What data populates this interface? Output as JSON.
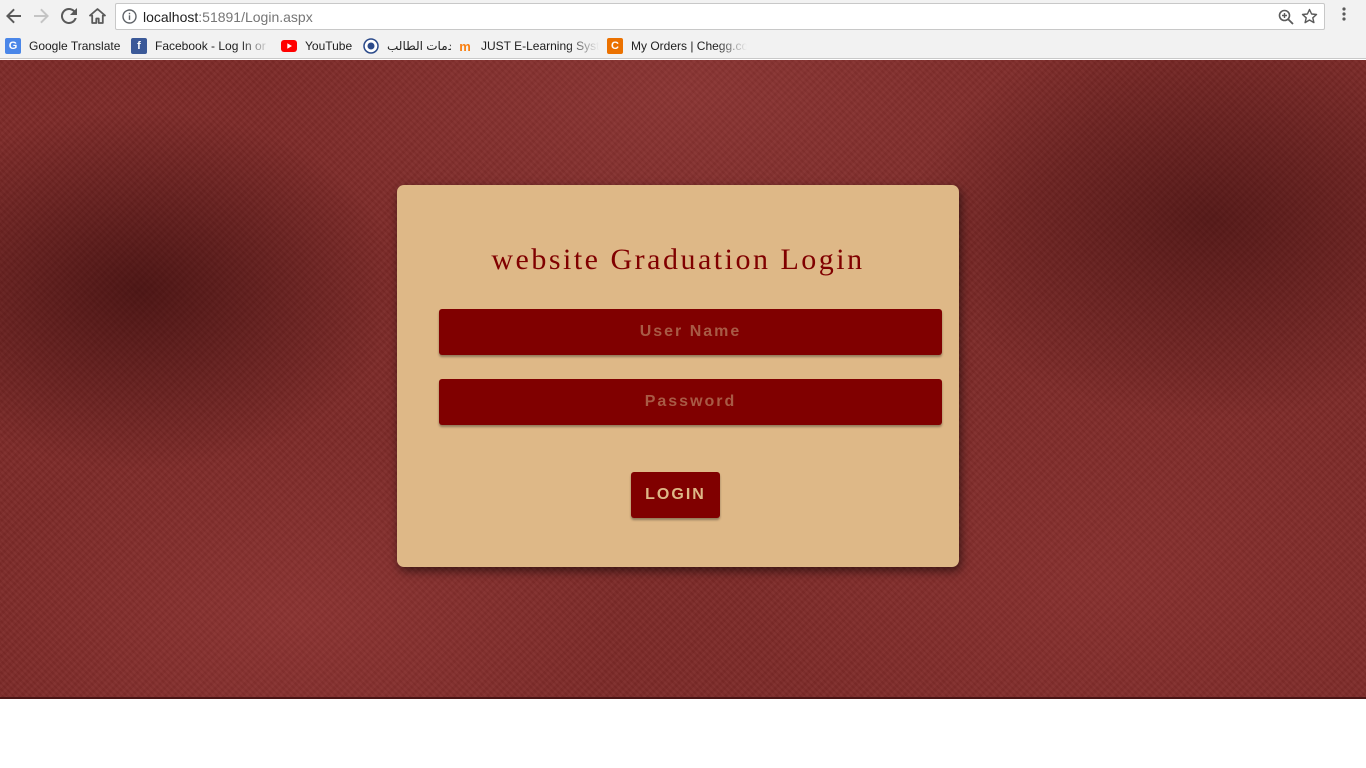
{
  "browser": {
    "url_host": "localhost",
    "url_rest": ":51891/Login.aspx",
    "bookmarks": [
      {
        "label": "Google Translate",
        "icon": "google-translate-icon",
        "color": "#4a86e8"
      },
      {
        "label": "Facebook - Log In or",
        "icon": "facebook-icon",
        "color": "#3b5998"
      },
      {
        "label": "YouTube",
        "icon": "youtube-icon",
        "color": "#ff0000"
      },
      {
        "label": "خدمات الطالب",
        "icon": "university-seal-icon",
        "color": "#2b4a8a"
      },
      {
        "label": "JUST E-Learning Syste",
        "icon": "moodle-icon",
        "color": "#f98012"
      },
      {
        "label": "My Orders | Chegg.co",
        "icon": "chegg-icon",
        "color": "#eb7100"
      }
    ]
  },
  "login": {
    "title": "website Graduation Login",
    "username_placeholder": "User Name",
    "password_placeholder": "Password",
    "button_label": "LOGIN"
  },
  "colors": {
    "page_background": "#7d2a28",
    "card_background": "#deb887",
    "accent": "#800000"
  }
}
